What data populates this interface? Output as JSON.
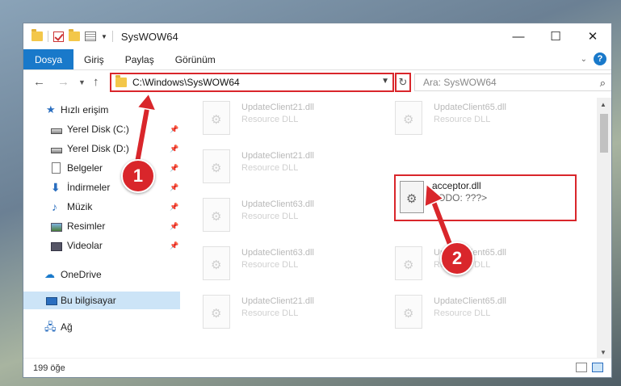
{
  "window": {
    "title": "SysWOW64",
    "controls": [
      "minimize",
      "maximize",
      "close"
    ]
  },
  "ribbon": {
    "tabs": [
      {
        "label": "Dosya",
        "active": true
      },
      {
        "label": "Giriş",
        "active": false
      },
      {
        "label": "Paylaş",
        "active": false
      },
      {
        "label": "Görünüm",
        "active": false
      }
    ],
    "help_label": "?"
  },
  "nav": {
    "address": "C:\\Windows\\SysWOW64",
    "search_placeholder": "Ara: SysWOW64"
  },
  "sidebar": {
    "items": [
      {
        "label": "Hızlı erişim",
        "icon": "star-icon"
      },
      {
        "label": "Yerel Disk (C:)",
        "icon": "drive-icon",
        "pinned": true
      },
      {
        "label": "Yerel Disk (D:)",
        "icon": "drive-icon",
        "pinned": true
      },
      {
        "label": "Belgeler",
        "icon": "documents-icon",
        "pinned": true
      },
      {
        "label": "İndirmeler",
        "icon": "download-icon",
        "pinned": true
      },
      {
        "label": "Müzik",
        "icon": "music-icon",
        "pinned": true
      },
      {
        "label": "Resimler",
        "icon": "pictures-icon",
        "pinned": true
      },
      {
        "label": "Videolar",
        "icon": "videos-icon",
        "pinned": true
      },
      {
        "label": "OneDrive",
        "icon": "cloud-icon"
      },
      {
        "label": "Bu bilgisayar",
        "icon": "computer-icon",
        "selected": true
      },
      {
        "label": "Ağ",
        "icon": "network-icon"
      }
    ]
  },
  "files": [
    {
      "name": "UpdateClient21.dll",
      "desc": "Resource DLL"
    },
    {
      "name": "UpdateClient65.dll",
      "desc": "Resource DLL"
    },
    {
      "name": "UpdateClient21.dll",
      "desc": "Resource DLL"
    },
    {
      "name": "UpdateClient63.dll",
      "desc": "Resource DLL"
    },
    {
      "name": "UpdateClient63.dll",
      "desc": "Resource DLL"
    },
    {
      "name": "UpdateClient65.dll",
      "desc": "Resource DLL"
    },
    {
      "name": "UpdateClient21.dll",
      "desc": "Resource DLL"
    },
    {
      "name": "UpdateClient65.dll",
      "desc": "Resource DLL"
    }
  ],
  "highlighted_file": {
    "name": "acceptor.dll",
    "desc": "TODO: ???>"
  },
  "status": {
    "count": "199 öğe"
  },
  "annotations": {
    "badge1": "1",
    "badge2": "2",
    "color": "#d9262b"
  }
}
